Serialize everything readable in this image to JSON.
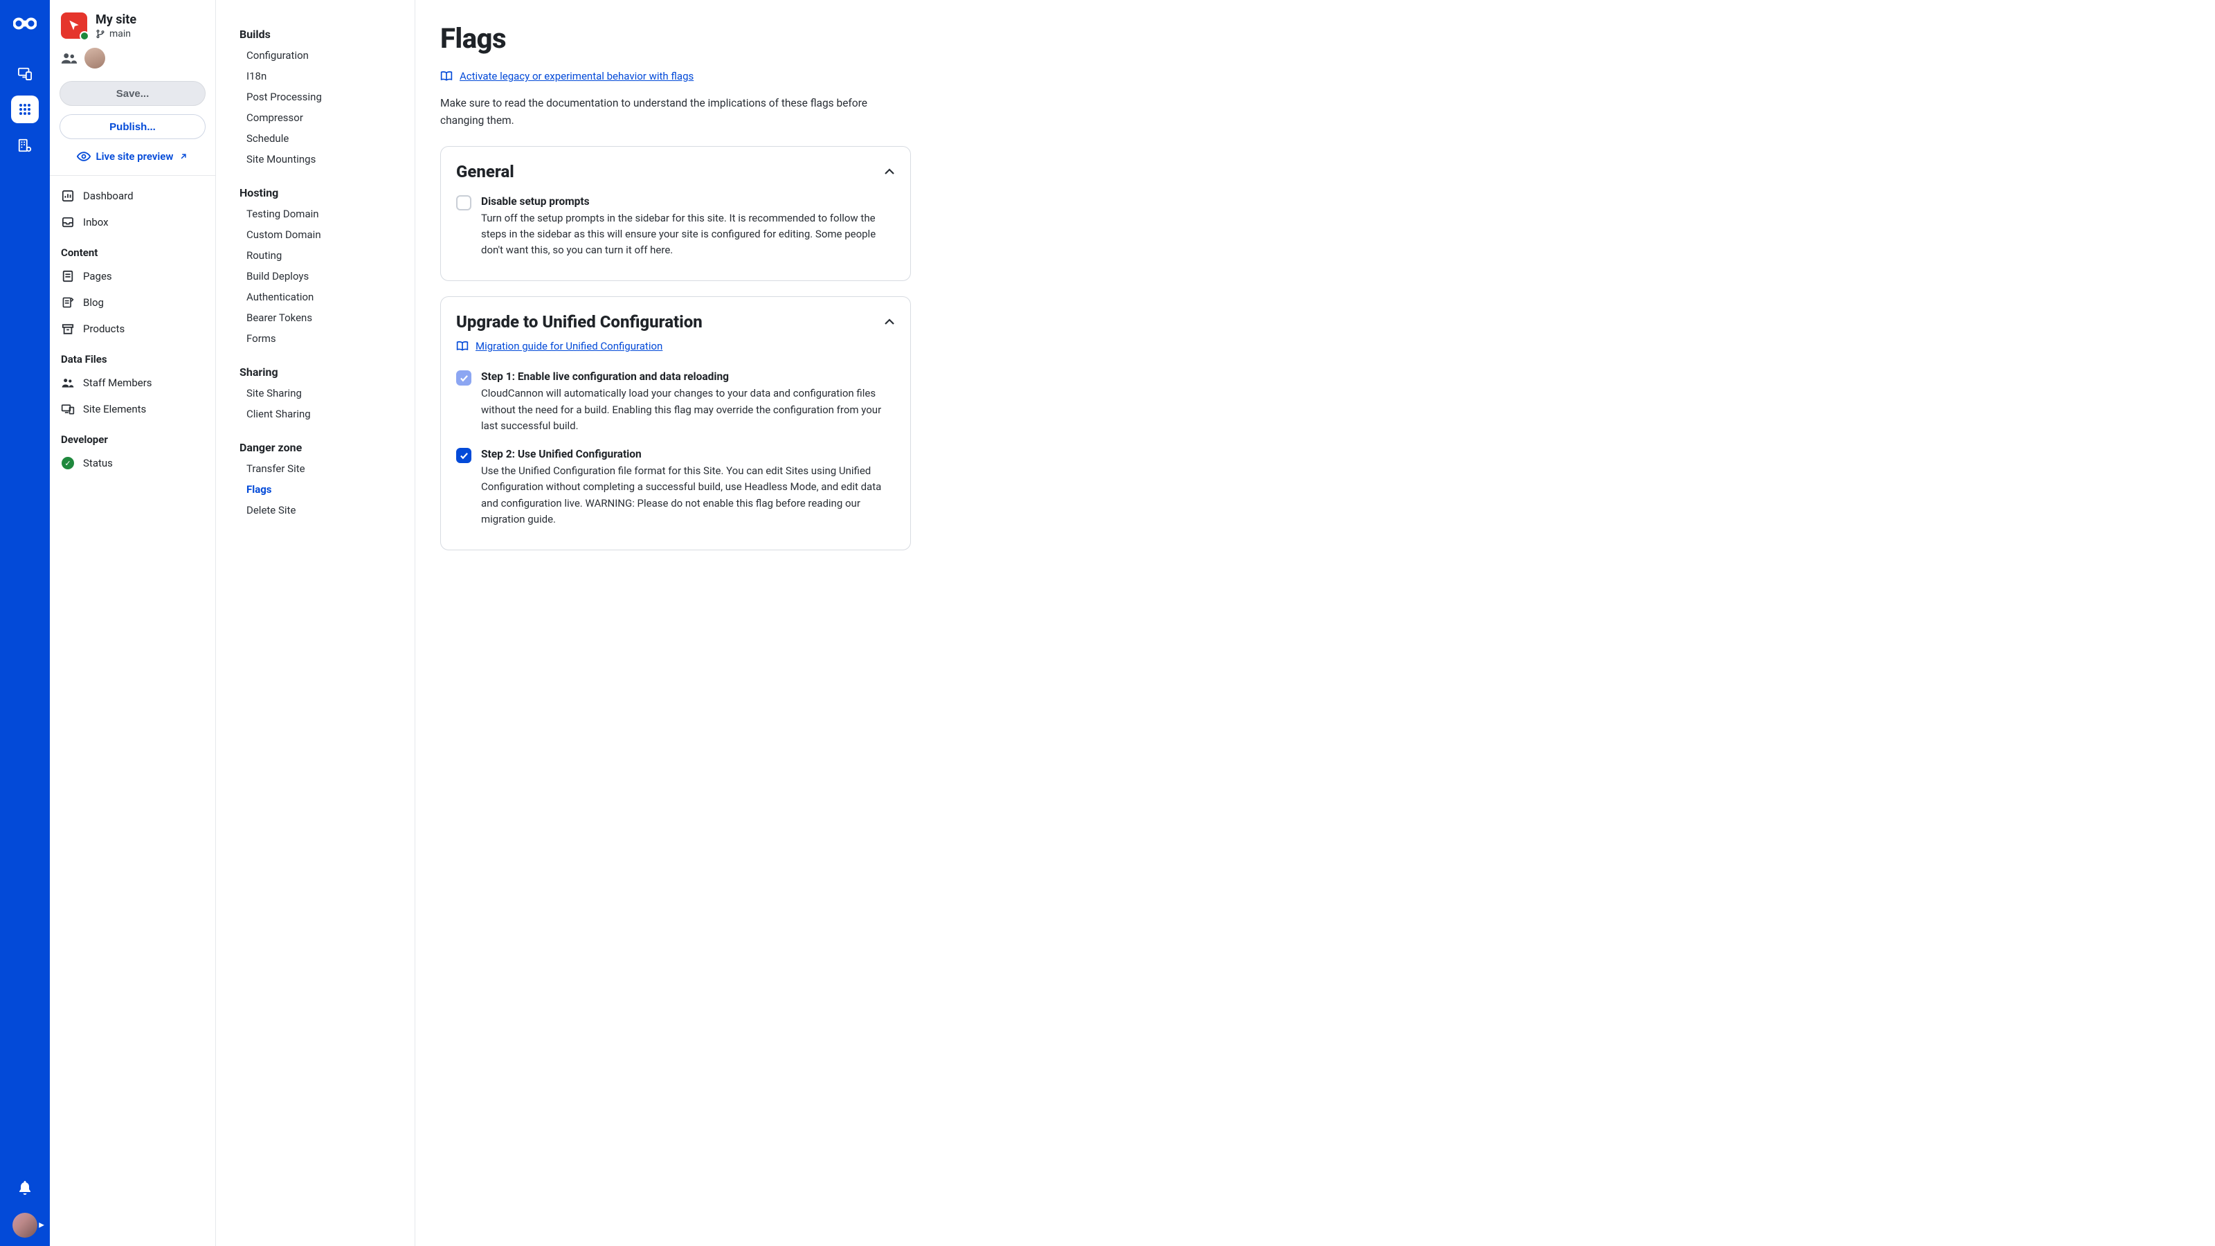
{
  "site": {
    "name": "My site",
    "branch": "main"
  },
  "actions": {
    "save": "Save...",
    "publish": "Publish...",
    "live_preview": "Live site preview"
  },
  "sidebar": {
    "items": {
      "dashboard": "Dashboard",
      "inbox": "Inbox"
    },
    "groups": {
      "content": {
        "heading": "Content",
        "pages": "Pages",
        "blog": "Blog",
        "products": "Products"
      },
      "data_files": {
        "heading": "Data Files",
        "staff": "Staff Members",
        "site_elements": "Site Elements"
      },
      "developer": {
        "heading": "Developer",
        "status": "Status"
      }
    }
  },
  "settings": {
    "builds": {
      "heading": "Builds",
      "items": [
        "Configuration",
        "I18n",
        "Post Processing",
        "Compressor",
        "Schedule",
        "Site Mountings"
      ]
    },
    "hosting": {
      "heading": "Hosting",
      "items": [
        "Testing Domain",
        "Custom Domain",
        "Routing",
        "Build Deploys",
        "Authentication",
        "Bearer Tokens",
        "Forms"
      ]
    },
    "sharing": {
      "heading": "Sharing",
      "items": [
        "Site Sharing",
        "Client Sharing"
      ]
    },
    "danger": {
      "heading": "Danger zone",
      "items": [
        "Transfer Site",
        "Flags",
        "Delete Site"
      ],
      "active": "Flags"
    }
  },
  "page": {
    "title": "Flags",
    "doc_link": "Activate legacy or experimental behavior with flags",
    "intro": "Make sure to read the documentation to understand the implications of these flags before changing them."
  },
  "cards": {
    "general": {
      "title": "General",
      "flag1_title": "Disable setup prompts",
      "flag1_desc": "Turn off the setup prompts in the sidebar for this site. It is recommended to follow the steps in the sidebar as this will ensure your site is configured for editing. Some people don't want this, so you can turn it off here."
    },
    "upgrade": {
      "title": "Upgrade to Unified Configuration",
      "sublink": "Migration guide for Unified Configuration",
      "step1_title": "Step 1: Enable live configuration and data reloading",
      "step1_desc": "CloudCannon will automatically load your changes to your data and configuration files without the need for a build. Enabling this flag may override the configuration from your last successful build.",
      "step2_title": "Step 2: Use Unified Configuration",
      "step2_desc": "Use the Unified Configuration file format for this Site. You can edit Sites using Unified Configuration without completing a successful build, use Headless Mode, and edit data and configuration live. WARNING: Please do not enable this flag before reading our migration guide."
    }
  }
}
